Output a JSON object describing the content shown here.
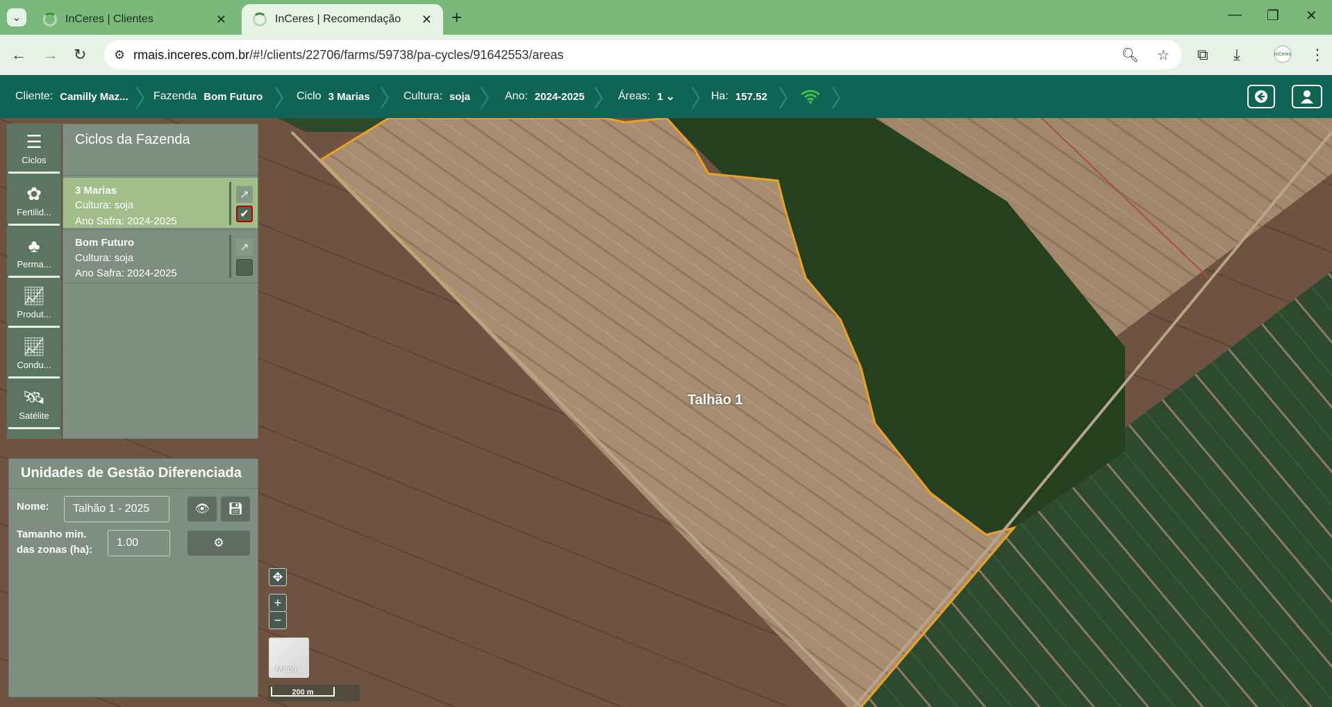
{
  "browser": {
    "tabs": [
      {
        "title": "InCeres | Clientes",
        "active": false
      },
      {
        "title": "InCeres | Recomendação",
        "active": true
      }
    ],
    "url_host": "rmais.inceres.com.br",
    "url_path": "/#!/clients/22706/farms/59738/pa-cycles/91642553/areas",
    "profile_label": "InCeres"
  },
  "header": {
    "cliente_label": "Cliente:",
    "cliente_value": "Camilly Maz...",
    "fazenda_label": "Fazenda",
    "fazenda_value": "Bom Futuro",
    "ciclo_label": "Ciclo",
    "ciclo_value": "3 Marias",
    "cultura_label": "Cultura:",
    "cultura_value": "soja",
    "ano_label": "Ano:",
    "ano_value": "2024-2025",
    "areas_label": "Áreas:",
    "areas_value": "1",
    "ha_label": "Ha:",
    "ha_value": "157.52",
    "wifi_color": "#3cc43c"
  },
  "menu": {
    "items": [
      {
        "label": "Ciclos",
        "icon": "list-icon"
      },
      {
        "label": "Fertilid...",
        "icon": "fertility-icon"
      },
      {
        "label": "Perma...",
        "icon": "plants-icon"
      },
      {
        "label": "Produt...",
        "icon": "chart-line-icon"
      },
      {
        "label": "Condu...",
        "icon": "chart-line-icon"
      },
      {
        "label": "Satélite",
        "icon": "satellite-icon"
      }
    ]
  },
  "cycles_panel": {
    "title": "Ciclos da Fazenda",
    "cycles": [
      {
        "name": "3 Marias",
        "cultura": "Cultura: soja",
        "ano": "Ano Safra: 2024-2025",
        "selected": true
      },
      {
        "name": "Bom Futuro",
        "cultura": "Cultura: soja",
        "ano": "Ano Safra: 2024-2025",
        "selected": false
      }
    ]
  },
  "ugd_panel": {
    "title": "Unidades de Gestão Diferenciada",
    "nome_label": "Nome:",
    "nome_value": "Talhão 1 - 2025",
    "tamanho_label_1": "Tamanho min.",
    "tamanho_label_2": "das zonas (ha):",
    "tamanho_value": "1.00"
  },
  "map": {
    "field_label": "Talhão 1",
    "basemap_label": "Mapa",
    "scale_label": "200 m",
    "boundary_color": "#f0a020"
  }
}
